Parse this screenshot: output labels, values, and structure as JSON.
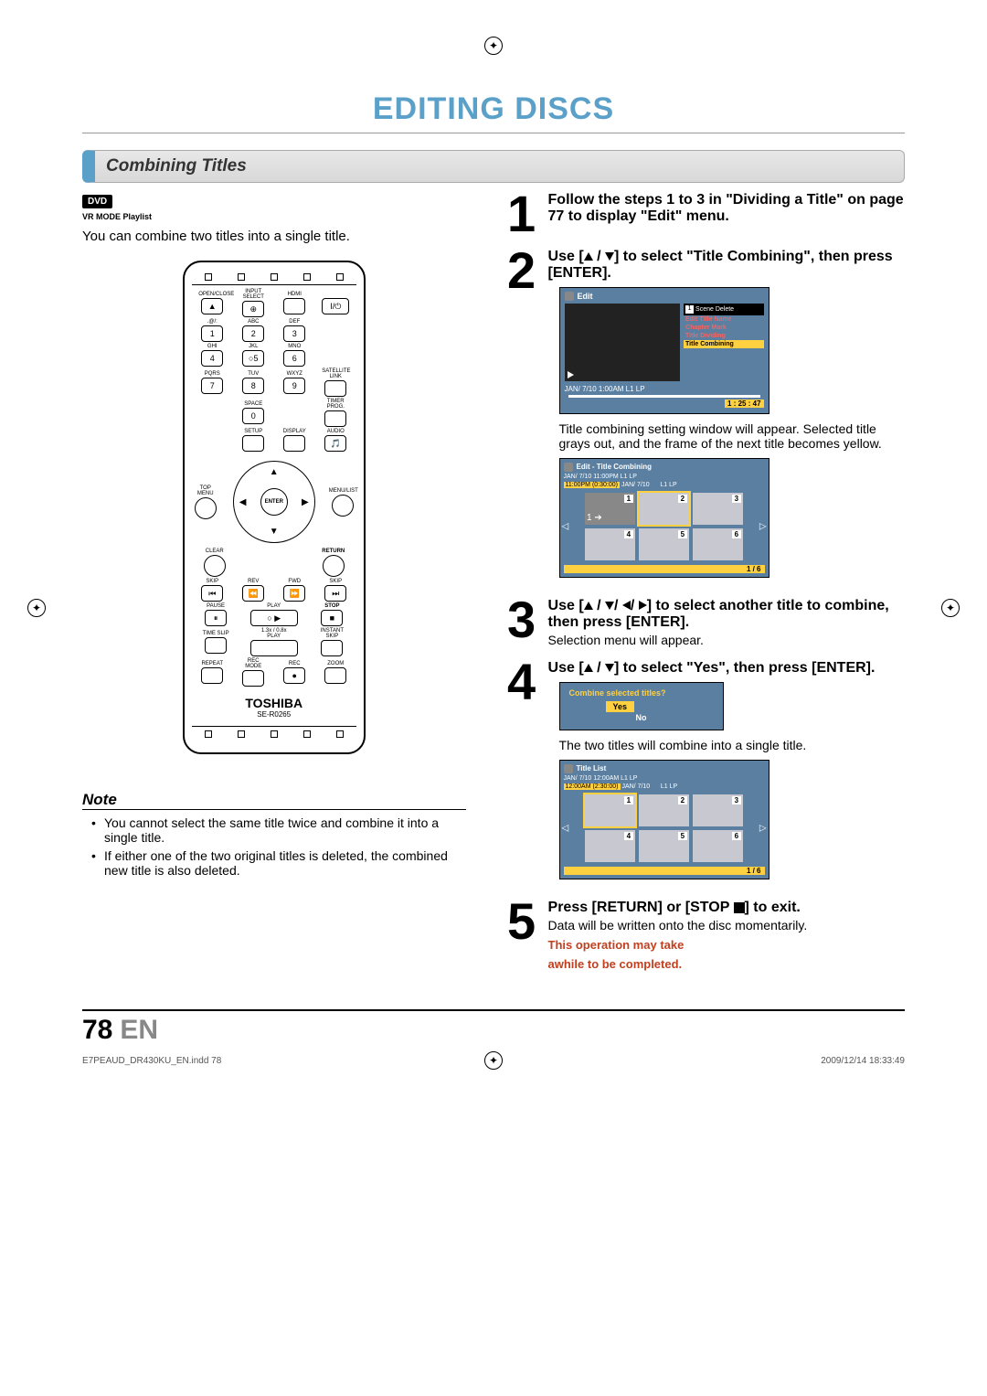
{
  "page_title": "EDITING DISCS",
  "section_heading": "Combining Titles",
  "dvd_badge": "DVD",
  "dvd_sub": "VR MODE Playlist",
  "intro_text": "You can combine two titles into a single title.",
  "remote": {
    "open_close": "OPEN/CLOSE",
    "input_select": "INPUT SELECT",
    "hdmi": "HDMI",
    "power": "I/⏻",
    "ghi": "GHI",
    "abc": "ABC",
    "def": "DEF",
    "jkl": "JKL",
    "mno": "MNO",
    "pqrs": "PQRS",
    "tuv": "TUV",
    "wxyz": "WXYZ",
    "space": "SPACE",
    "timer_prog": "TIMER PROG.",
    "satellite": "SATELLITE LINK",
    "setup": "SETUP",
    "display": "DISPLAY",
    "audio": "AUDIO",
    "top_menu": "TOP MENU",
    "menu_list": "MENU/LIST",
    "enter": "ENTER",
    "clear": "CLEAR",
    "return": "RETURN",
    "skip": "SKIP",
    "rev": "REV",
    "fwd": "FWD",
    "pause": "PAUSE",
    "play": "PLAY",
    "stop": "STOP",
    "time_slip": "TIME SLIP",
    "speed_play": "1.3x / 0.8x PLAY",
    "instant_skip": "INSTANT SKIP",
    "repeat": "REPEAT",
    "rec_mode": "REC MODE",
    "rec": "REC",
    "zoom": "ZOOM",
    "brand": "TOSHIBA",
    "model": "SE-R0265"
  },
  "steps": [
    {
      "n": "1",
      "bold": "Follow the steps 1 to 3 in \"Dividing a Title\" on page 77 to display \"Edit\" menu."
    },
    {
      "n": "2",
      "bold_pre": "Use [",
      "bold_post": "] to select \"Title Combining\", then press [ENTER].",
      "after": "Title combining setting window will appear. Selected title grays out, and the frame of the next title becomes yellow.",
      "edit_menu_title": "Edit",
      "edit_timestamp": "JAN/ 7/10 1:00AM L1   LP",
      "edit_progress_time": "1 : 25 : 47",
      "menu_items": [
        "Scene Delete",
        "Edit Title Name",
        "Chapter Mark",
        "Title Dividing",
        "Title Combining"
      ],
      "menu_highlight_index": 4,
      "menu_number": "1",
      "grid_title": "Edit - Title Combining",
      "grid_meta_line1": "JAN/ 7/10 11:00PM  L1  LP",
      "grid_meta_time": "11:00PM (0:30:00)",
      "grid_meta_date": "JAN/ 7/10",
      "grid_meta_right": "L1  LP",
      "grid_pages": "1 / 6",
      "thumbs": [
        "1",
        "2",
        "3",
        "4",
        "5",
        "6"
      ]
    },
    {
      "n": "3",
      "bold_pre": "Use [",
      "bold_post": "] to select another title to combine, then press [ENTER].",
      "after": "Selection menu will appear."
    },
    {
      "n": "4",
      "bold_pre": "Use [",
      "bold_post": "] to select \"Yes\", then press [ENTER].",
      "prompt_q": "Combine selected titles?",
      "prompt_yes": "Yes",
      "prompt_no": "No",
      "after2": "The two titles will combine into a single title.",
      "grid2_title": "Title List",
      "grid2_meta_line1": "JAN/ 7/10 12:00AM  L1  LP",
      "grid2_meta_time": "12:00AM (2:30:00)",
      "grid2_meta_date": "JAN/ 7/10",
      "grid2_meta_right": "L1 LP",
      "grid2_pages": "1 / 6",
      "thumbs2": [
        "1",
        "2",
        "3",
        "4",
        "5",
        "6"
      ]
    },
    {
      "n": "5",
      "bold": "Press [RETURN] or [STOP ■] to exit.",
      "after": "Data will be written onto the disc momentarily.",
      "warn1": "This operation may take",
      "warn2": "awhile to be completed."
    }
  ],
  "note_head": "Note",
  "notes": [
    "You cannot select the same title twice and combine it into a single title.",
    "If either one of the two original titles is deleted, the combined new title is also deleted."
  ],
  "footer_page": "78",
  "footer_lang": "EN",
  "imprint_left": "E7PEAUD_DR430KU_EN.indd   78",
  "imprint_right": "2009/12/14   18:33:49"
}
